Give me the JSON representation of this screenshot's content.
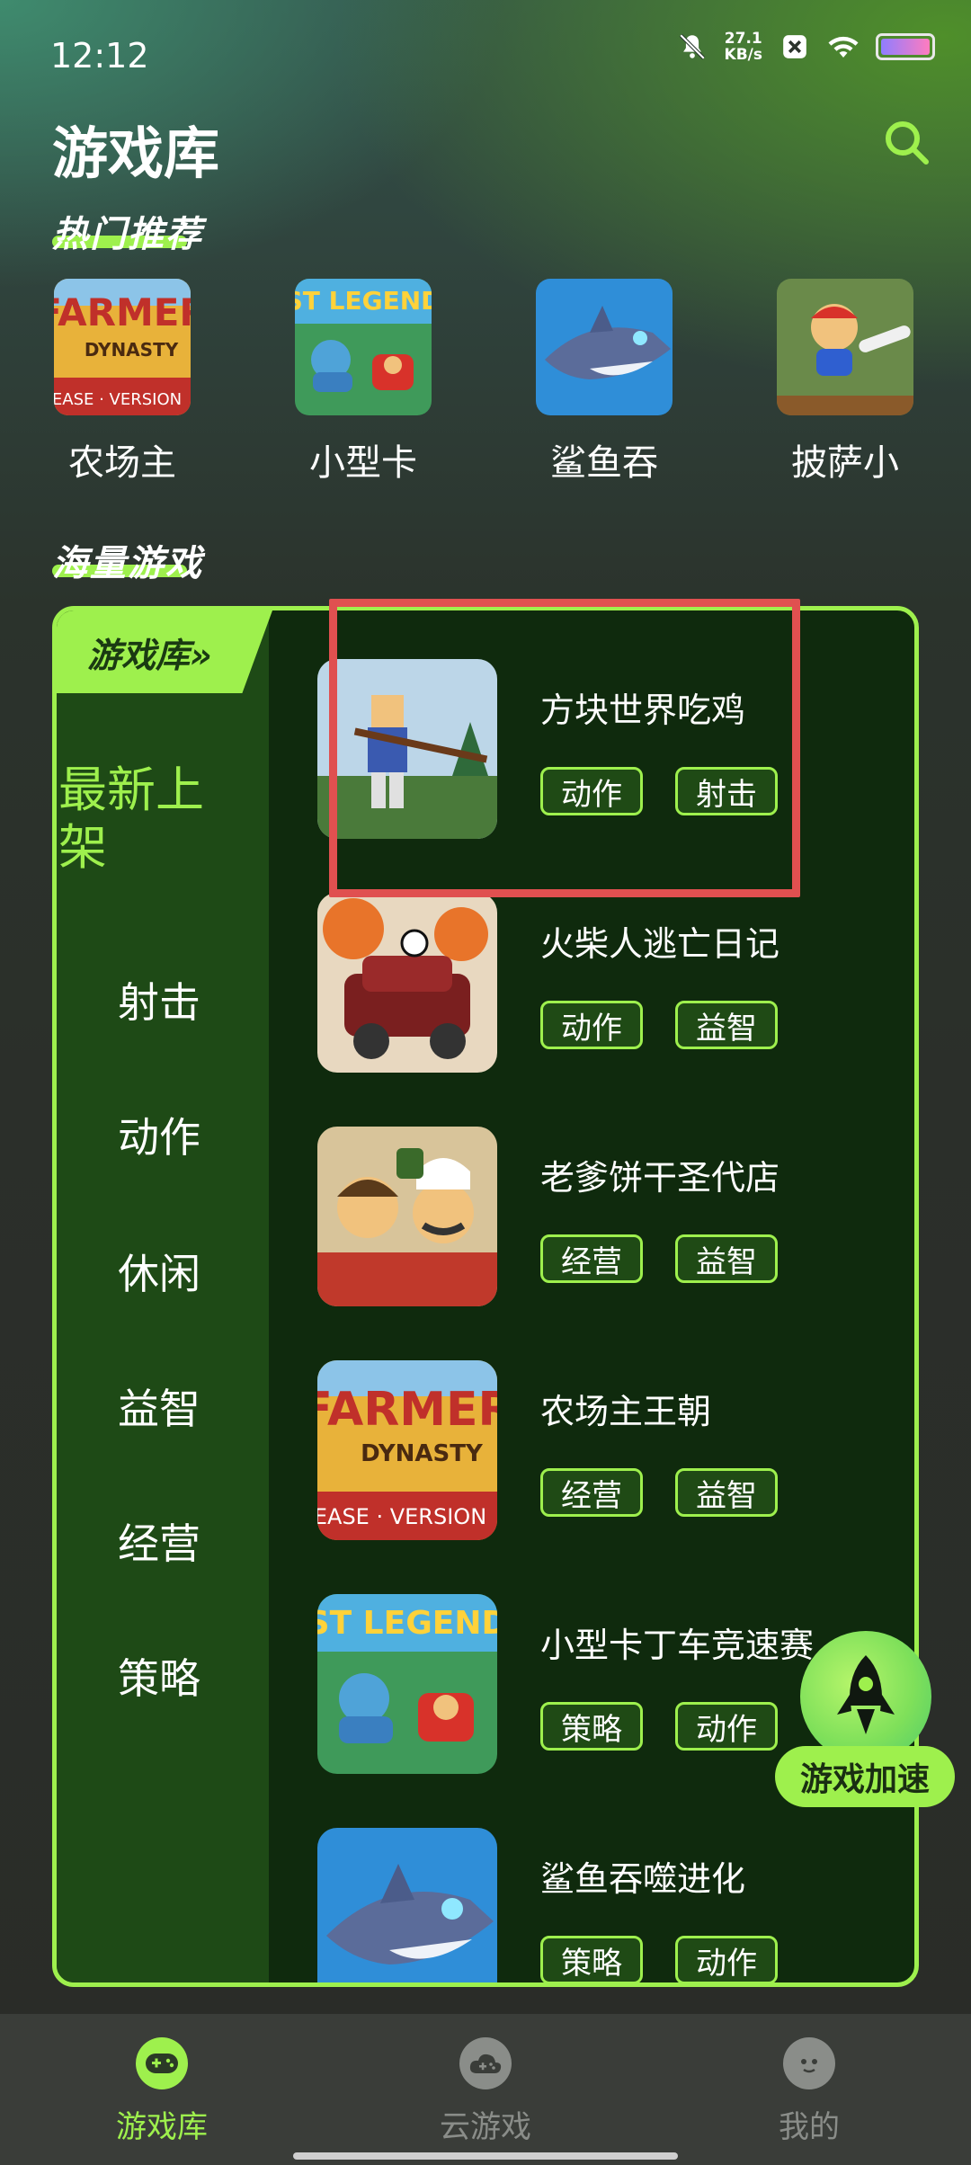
{
  "status_bar": {
    "time": "12:12",
    "net_speed_value": "27.1",
    "net_speed_unit": "KB/s",
    "icons": [
      "bell-off-icon",
      "close-box-icon",
      "wifi-icon",
      "battery-icon"
    ]
  },
  "header": {
    "title": "游戏库",
    "search_icon": "search-icon"
  },
  "hot": {
    "title": "热门推荐",
    "items": [
      {
        "label": "农场主"
      },
      {
        "label": "小型卡"
      },
      {
        "label": "鲨鱼吞"
      },
      {
        "label": "披萨小"
      }
    ]
  },
  "mass": {
    "title": "海量游戏"
  },
  "library": {
    "tab_label": "游戏库»",
    "categories": [
      "最新上架",
      "射击",
      "动作",
      "休闲",
      "益智",
      "经营",
      "策略"
    ],
    "games": [
      {
        "name": "方块世界吃鸡",
        "tags": [
          "动作",
          "射击"
        ]
      },
      {
        "name": "火柴人逃亡日记",
        "tags": [
          "动作",
          "益智"
        ]
      },
      {
        "name": "老爹饼干圣代店",
        "tags": [
          "经营",
          "益智"
        ]
      },
      {
        "name": "农场主王朝",
        "tags": [
          "经营",
          "益智"
        ]
      },
      {
        "name": "小型卡丁车竞速赛",
        "tags": [
          "策略",
          "动作"
        ]
      },
      {
        "name": "鲨鱼吞噬进化",
        "tags": [
          "策略",
          "动作"
        ]
      }
    ]
  },
  "boost": {
    "label": "游戏加速",
    "icon": "rocket-icon"
  },
  "bottom_nav": {
    "items": [
      {
        "label": "游戏库",
        "icon": "gamepad-icon",
        "active": true
      },
      {
        "label": "云游戏",
        "icon": "cloud-gamepad-icon",
        "active": false
      },
      {
        "label": "我的",
        "icon": "face-icon",
        "active": false
      }
    ],
    "active_color": "#9ef04d",
    "inactive_color": "#8a8d89"
  },
  "colors": {
    "accent": "#9ef04d",
    "highlight": "#e05050"
  }
}
